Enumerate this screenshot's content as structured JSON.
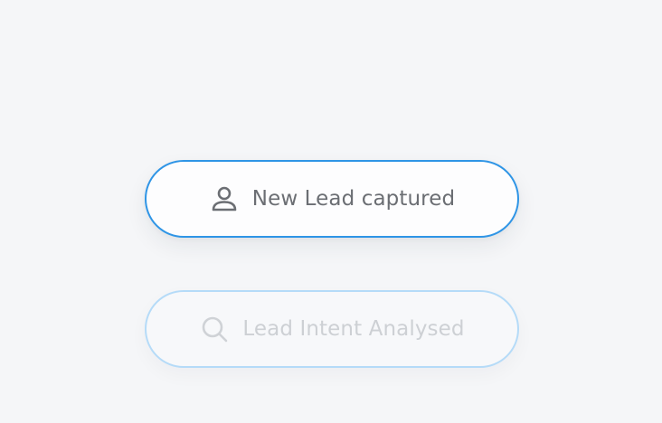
{
  "steps": [
    {
      "label": "New Lead captured",
      "icon": "user-icon",
      "state": "active",
      "border_color": "#2f95e6"
    },
    {
      "label": "Lead Intent Analysed",
      "icon": "search-icon",
      "state": "inactive",
      "border_color": "#b5dbf8"
    }
  ],
  "colors": {
    "background": "#f5f6f8",
    "accent": "#2f95e6"
  }
}
